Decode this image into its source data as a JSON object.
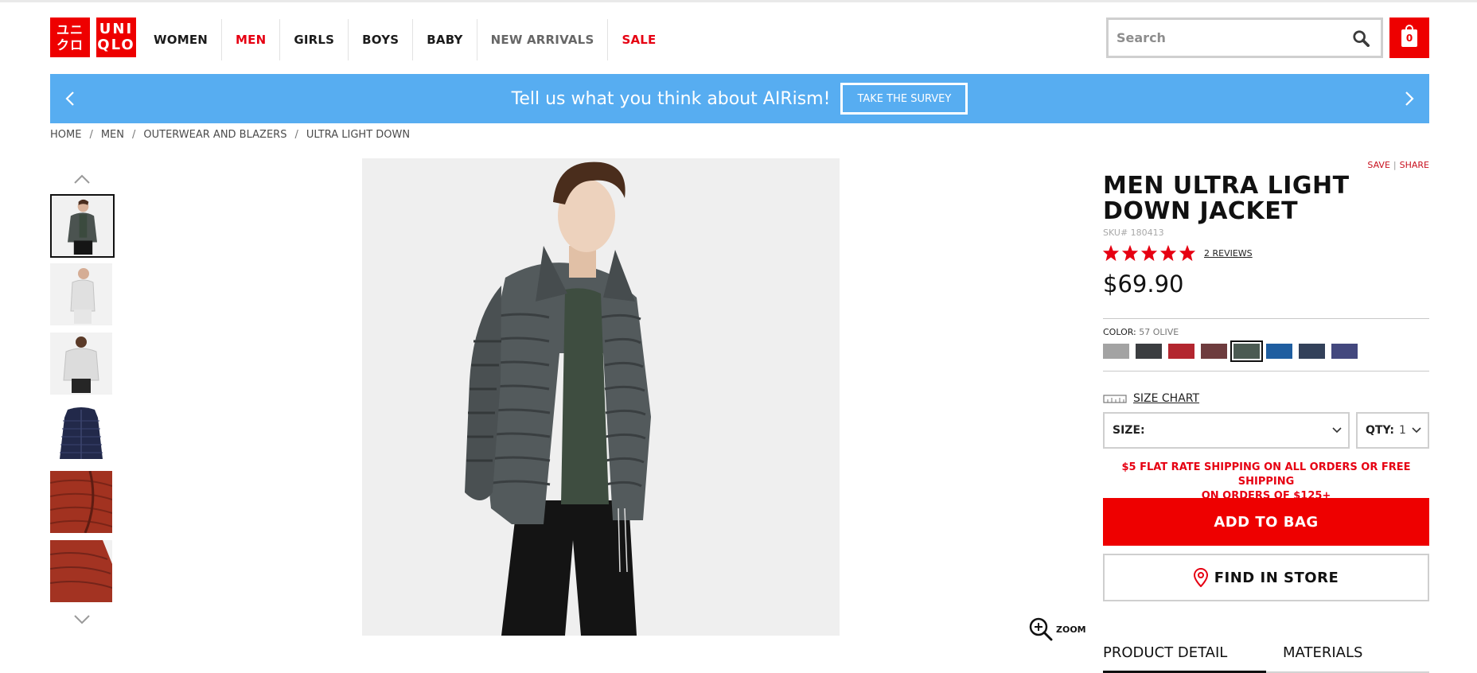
{
  "brand": {
    "logo_jp_lines": [
      "ユニ",
      "クロ"
    ],
    "logo_en_lines": [
      "UNI",
      "QLO"
    ],
    "accent_color": "#ee0000"
  },
  "nav": {
    "items": [
      {
        "label": "WOMEN"
      },
      {
        "label": "MEN"
      },
      {
        "label": "GIRLS"
      },
      {
        "label": "BOYS"
      },
      {
        "label": "BABY"
      },
      {
        "label": "NEW ARRIVALS"
      },
      {
        "label": "SALE"
      }
    ]
  },
  "search": {
    "placeholder": "Search",
    "icon": "search-icon"
  },
  "bag": {
    "count": "0",
    "icon": "shopping-bag-icon"
  },
  "banner": {
    "text": "Tell us what you think about AIRism!",
    "button_label": "TAKE THE SURVEY",
    "color": "#57adf1"
  },
  "breadcrumb": [
    "HOME",
    "MEN",
    "OUTERWEAR AND BLAZERS",
    "ULTRA LIGHT DOWN"
  ],
  "gallery": {
    "thumbnail_count": 6,
    "selected_index": 0,
    "zoom_label": "ZOOM"
  },
  "product": {
    "save_label": "SAVE",
    "share_label": "SHARE",
    "title": "MEN ULTRA LIGHT DOWN JACKET",
    "sku": "SKU# 180413",
    "rating_stars": 5,
    "reviews_label": "2 REVIEWS",
    "price": "$69.90",
    "color_label": "COLOR:",
    "color_value": "57 OLIVE",
    "swatches": [
      "#a3a3a3",
      "#3b3d40",
      "#b3262f",
      "#6e3c3e",
      "#4b5a52",
      "#1f5ea0",
      "#33415a",
      "#43487e"
    ],
    "selected_swatch": 4,
    "size_chart_label": "SIZE CHART",
    "size_label": "SIZE:",
    "qty_label": "QTY:",
    "qty_value": "1",
    "shipping_line1": "$5 FLAT RATE SHIPPING ON ALL ORDERS OR FREE SHIPPING",
    "shipping_line2": "ON ORDERS OF $125+",
    "add_to_bag_label": "ADD TO BAG",
    "find_in_store_label": "FIND IN STORE",
    "tabs": [
      "PRODUCT DETAIL",
      "MATERIALS"
    ]
  }
}
